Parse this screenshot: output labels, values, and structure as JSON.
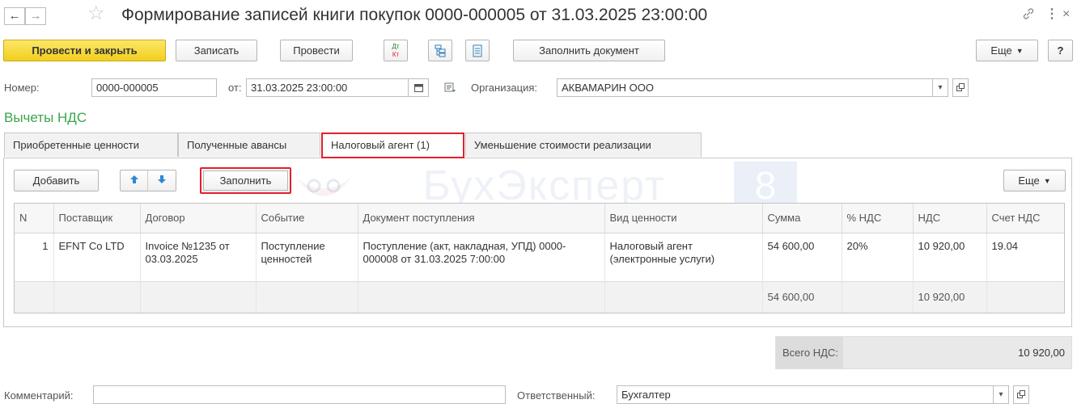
{
  "window": {
    "title": "Формирование записей книги покупок 0000-000005 от 31.03.2025 23:00:00",
    "back_icon": "←",
    "forward_icon": "→",
    "star_icon": "☆",
    "link_icon": "🔗",
    "more_icon": "⋮",
    "close_icon": "×"
  },
  "toolbar": {
    "post_close": "Провести и закрыть",
    "save": "Записать",
    "post": "Провести",
    "dt_kt_icon": "ДтКт",
    "fill_document": "Заполнить документ",
    "more": "Еще",
    "help": "?"
  },
  "header": {
    "number_label": "Номер:",
    "number_value": "0000-000005",
    "date_label": "от:",
    "date_value": "31.03.2025 23:00:00",
    "org_label": "Организация:",
    "org_value": "АКВАМАРИН ООО"
  },
  "section_title": "Вычеты НДС",
  "tabs": [
    {
      "label": "Приобретенные ценности"
    },
    {
      "label": "Полученные авансы"
    },
    {
      "label": "Налоговый агент (1)"
    },
    {
      "label": "Уменьшение стоимости реализации"
    }
  ],
  "table_toolbar": {
    "add": "Добавить",
    "fill": "Заполнить",
    "more": "Еще"
  },
  "watermark": {
    "text": "БухЭксперт",
    "digit": "8"
  },
  "table": {
    "columns": [
      "N",
      "Поставщик",
      "Договор",
      "Событие",
      "Документ поступления",
      "Вид ценности",
      "Сумма",
      "% НДС",
      "НДС",
      "Счет НДС"
    ],
    "rows": [
      {
        "n": "1",
        "supplier": "EFNT Co LTD",
        "contract": "Invoice №1235 от 03.03.2025",
        "event": "Поступление ценностей",
        "document": "Поступление (акт, накладная, УПД) 0000-000008 от 31.03.2025 7:00:00",
        "kind": "Налоговый агент (электронные услуги)",
        "sum": "54 600,00",
        "vat_rate": "20%",
        "vat": "10 920,00",
        "vat_account": "19.04"
      }
    ],
    "footer": {
      "sum": "54 600,00",
      "vat": "10 920,00"
    }
  },
  "totals": {
    "label": "Всего НДС:",
    "value": "10 920,00"
  },
  "footer": {
    "comment_label": "Комментарий:",
    "comment_value": "",
    "responsible_label": "Ответственный:",
    "responsible_value": "Бухгалтер"
  },
  "colors": {
    "accent_yellow": "#f2cf1c",
    "highlight_red": "#e0212b",
    "section_green": "#3aa64a"
  }
}
